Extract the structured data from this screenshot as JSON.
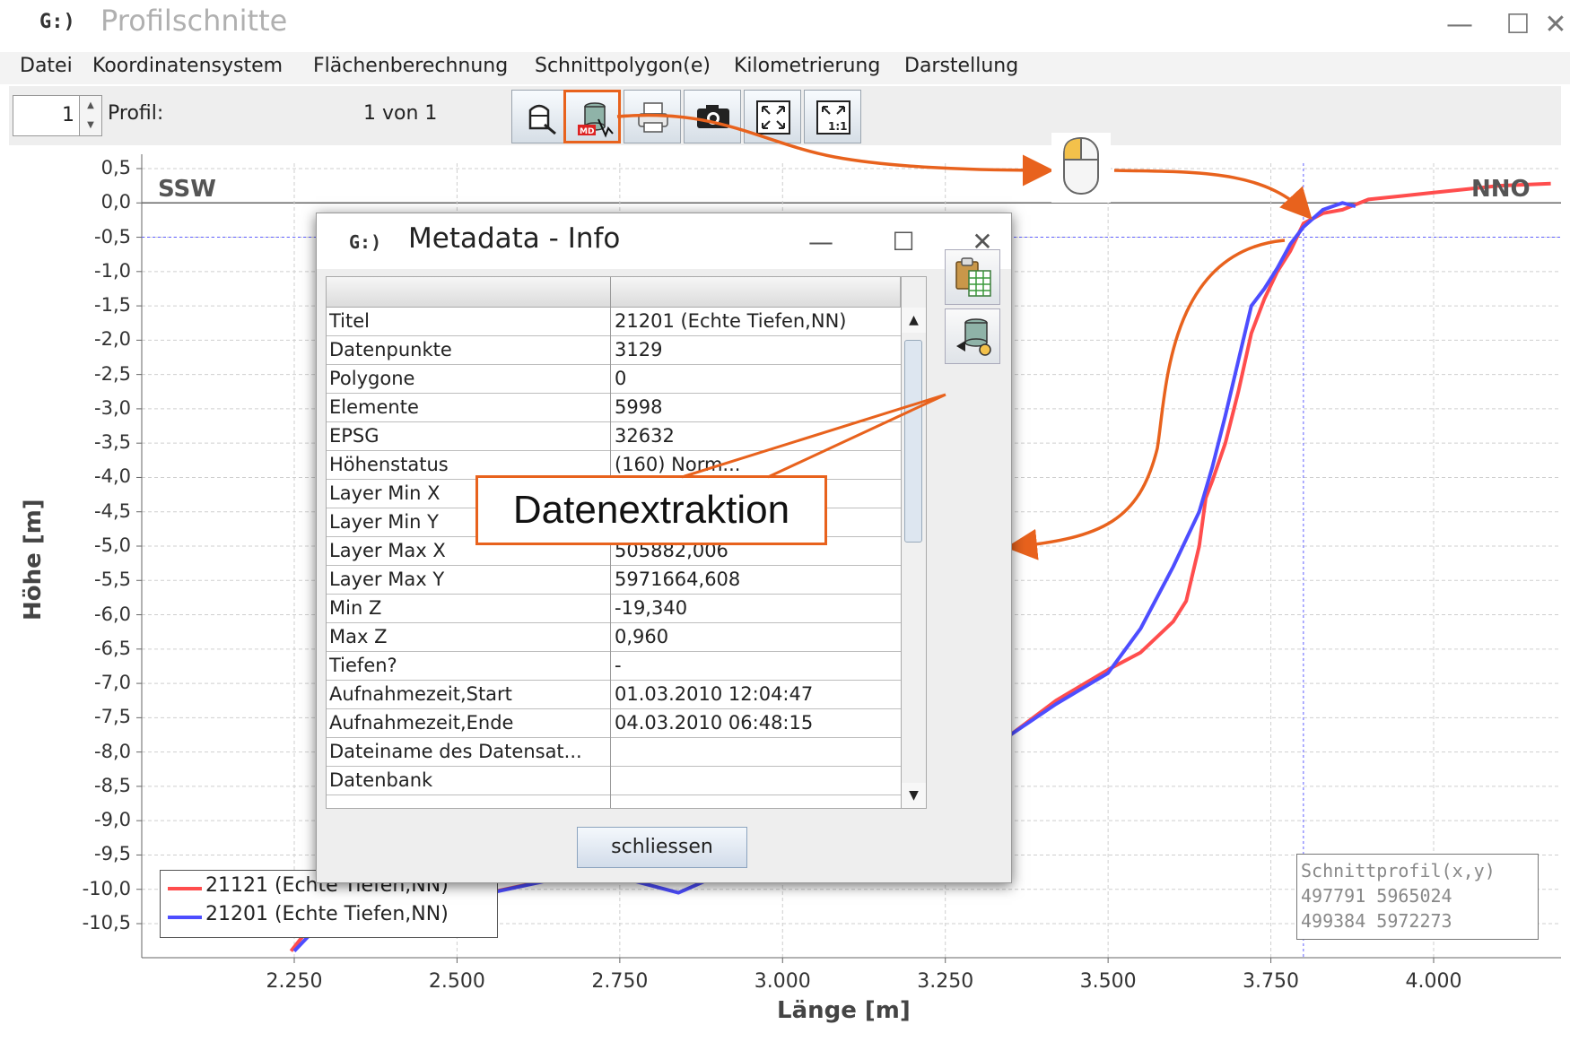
{
  "window": {
    "logo": "G:)",
    "title": "Profilschnitte",
    "minimize": "—",
    "maximize": "☐",
    "close": "✕"
  },
  "menu": [
    "Datei",
    "Koordinatensystem",
    "Flächenberechnung",
    "Schnittpolygon(e)",
    "Kilometrierung",
    "Darstellung"
  ],
  "toolbar": {
    "spinner_value": "1",
    "profil_label": "Profil:",
    "profil_count": "1 von 1",
    "buttons": [
      "select-profile-icon",
      "metadata-info-icon",
      "print-icon",
      "camera-icon",
      "zoom-fit-icon",
      "zoom-1to1-icon"
    ],
    "highlight_color": "#e8621d"
  },
  "chart_data": {
    "type": "line",
    "xlabel": "Länge [m]",
    "ylabel": "Höhe [m]",
    "xlim": [
      2100,
      4180
    ],
    "ylim": [
      -10.9,
      0.5
    ],
    "x_ticks": [
      "2.250",
      "2.500",
      "2.750",
      "3.000",
      "3.250",
      "3.500",
      "3.750",
      "4.000"
    ],
    "x_tick_values": [
      2250,
      2500,
      2750,
      3000,
      3250,
      3500,
      3750,
      4000
    ],
    "y_ticks": [
      "0,5",
      "0,0",
      "-0,5",
      "-1,0",
      "-1,5",
      "-2,0",
      "-2,5",
      "-3,0",
      "-3,5",
      "-4,0",
      "-4,5",
      "-5,0",
      "-5,5",
      "-6,0",
      "-6,5",
      "-7,0",
      "-7,5",
      "-8,0",
      "-8,5",
      "-9,0",
      "-9,5",
      "-10,0",
      "-10,5"
    ],
    "y_tick_values": [
      0.5,
      0,
      -0.5,
      -1,
      -1.5,
      -2,
      -2.5,
      -3,
      -3.5,
      -4,
      -4.5,
      -5,
      -5.5,
      -6,
      -6.5,
      -7,
      -7.5,
      -8,
      -8.5,
      -9,
      -9.5,
      -10,
      -10.5
    ],
    "grid": true,
    "left_direction": "SSW",
    "right_direction": "NNO",
    "legend_position": "bottom-left",
    "series": [
      {
        "name": "21121 (Echte Tiefen,NN)",
        "color": "#ff4d4d",
        "x": [
          2245,
          2270,
          2700,
          2760,
          2830,
          3000,
          3100,
          3350,
          3420,
          3500,
          3550,
          3600,
          3620,
          3640,
          3650,
          3660,
          3680,
          3700,
          3720,
          3740,
          3760,
          3780,
          3800,
          3830,
          3860,
          3900,
          3950,
          4000,
          4050,
          4100,
          4180
        ],
        "y": [
          -10.9,
          -10.6,
          -9.75,
          -9.8,
          -9.8,
          -9.85,
          -9.7,
          -7.75,
          -7.25,
          -6.8,
          -6.55,
          -6.1,
          -5.8,
          -5.0,
          -4.3,
          -4.05,
          -3.5,
          -2.75,
          -1.9,
          -1.4,
          -1.0,
          -0.7,
          -0.3,
          -0.15,
          -0.1,
          0.05,
          0.1,
          0.15,
          0.2,
          0.25,
          0.28
        ]
      },
      {
        "name": "21201 (Echte Tiefen,NN)",
        "color": "#4d4dff",
        "x": [
          2250,
          2280,
          2700,
          2760,
          2840,
          2900,
          3000,
          3100,
          3350,
          3420,
          3500,
          3550,
          3600,
          3640,
          3660,
          3680,
          3700,
          3720,
          3740,
          3760,
          3780,
          3800,
          3830,
          3860,
          3880
        ],
        "y": [
          -10.9,
          -10.6,
          -9.75,
          -9.85,
          -10.05,
          -9.8,
          -9.75,
          -9.7,
          -7.75,
          -7.3,
          -6.85,
          -6.2,
          -5.3,
          -4.5,
          -3.85,
          -3.1,
          -2.3,
          -1.5,
          -1.25,
          -0.95,
          -0.6,
          -0.35,
          -0.1,
          0.0,
          -0.05
        ]
      }
    ],
    "reference_lines": {
      "horizontal_y": -0.5,
      "vertical_x": 3800,
      "color": "#6060ff"
    }
  },
  "coords_box": {
    "title": "Schnittprofil(x,y)",
    "line1": "497791  5965024",
    "line2": "499384  5972273"
  },
  "dialog": {
    "logo": "G:)",
    "title": "Metadata - Info",
    "minimize": "—",
    "maximize": "☐",
    "close": "✕",
    "rows": [
      {
        "key": "Titel",
        "value": "21201 (Echte Tiefen,NN)"
      },
      {
        "key": "Datenpunkte",
        "value": "3129"
      },
      {
        "key": "Polygone",
        "value": "0"
      },
      {
        "key": "Elemente",
        "value": "5998"
      },
      {
        "key": "EPSG",
        "value": "32632"
      },
      {
        "key": "Höhenstatus",
        "value": "(160) Norm..."
      },
      {
        "key": "Layer Min X",
        "value": ""
      },
      {
        "key": "Layer Min Y",
        "value": ""
      },
      {
        "key": "Layer Max X",
        "value": "505882,006"
      },
      {
        "key": "Layer Max Y",
        "value": "5971664,608"
      },
      {
        "key": "Min Z",
        "value": "-19,340"
      },
      {
        "key": "Max Z",
        "value": "0,960"
      },
      {
        "key": "Tiefen?",
        "value": " -"
      },
      {
        "key": "Aufnahmezeit,Start",
        "value": "01.03.2010 12:04:47"
      },
      {
        "key": "Aufnahmezeit,Ende",
        "value": "04.03.2010 06:48:15"
      },
      {
        "key": "Dateiname des Datensat...",
        "value": ""
      },
      {
        "key": "Datenbank",
        "value": ""
      }
    ],
    "side_buttons": [
      "copy-to-spreadsheet-icon",
      "data-extraction-icon"
    ],
    "close_button": "schliessen"
  },
  "annotation": {
    "callout_text": "Datenextraktion",
    "color": "#e8621d",
    "mouse_icon": "mouse-left-click-icon"
  }
}
